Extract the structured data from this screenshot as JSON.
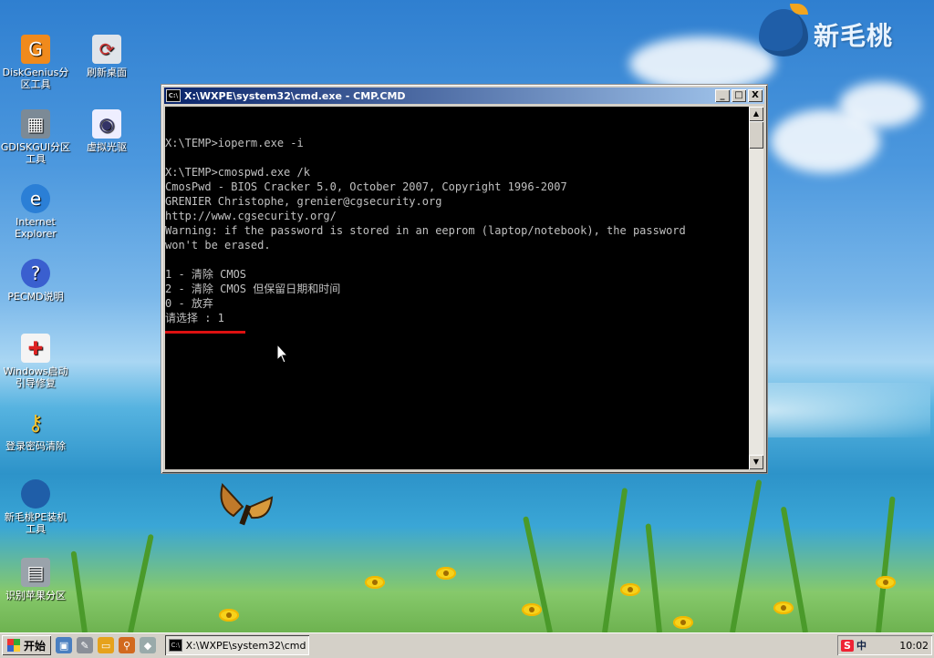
{
  "brand": {
    "text": "新毛桃"
  },
  "desktop_icons": [
    {
      "label": "DiskGenius分区工具",
      "icon": "diskgenius-icon"
    },
    {
      "label": "刷新桌面",
      "icon": "refresh-desktop-icon"
    },
    {
      "label": "GDISKGUI分区工具",
      "icon": "gdiskgui-icon"
    },
    {
      "label": "虚拟光驱",
      "icon": "virtual-drive-icon"
    },
    {
      "label": "Internet Explorer",
      "icon": "internet-explorer-icon"
    },
    {
      "label": "PECMD说明",
      "icon": "help-icon"
    },
    {
      "label": "Windows启动引导修复",
      "icon": "boot-repair-icon"
    },
    {
      "label": "登录密码清除",
      "icon": "key-icon"
    },
    {
      "label": "新毛桃PE装机工具",
      "icon": "peach-installer-icon"
    },
    {
      "label": "识别苹果分区",
      "icon": "apple-partition-icon"
    }
  ],
  "window": {
    "title": "X:\\WXPE\\system32\\cmd.exe - CMP.CMD",
    "title_icon_text": "C:\\",
    "minimize": "_",
    "maximize": "□",
    "close": "X"
  },
  "console_lines": [
    "",
    "X:\\TEMP>ioperm.exe -i",
    "",
    "X:\\TEMP>cmospwd.exe /k",
    "CmosPwd - BIOS Cracker 5.0, October 2007, Copyright 1996-2007",
    "GRENIER Christophe, grenier@cgsecurity.org",
    "http://www.cgsecurity.org/",
    "Warning: if the password is stored in an eeprom (laptop/notebook), the password",
    "won't be erased.",
    "",
    "1 - 清除 CMOS",
    "2 - 清除 CMOS 但保留日期和时间",
    "0 - 放弃",
    "请选择 : 1"
  ],
  "taskbar": {
    "start_label": "开始",
    "task_label": "X:\\WXPE\\system32\\cmd....",
    "task_icon_text": "C:\\",
    "ime_label": "S",
    "lang_label": "中",
    "clock": "10:02"
  },
  "colors": {
    "title_active_start": "#0a246a",
    "title_active_end": "#a6caf0",
    "console_bg": "#000000",
    "console_fg": "#c0c0c0",
    "highlight_underline": "#dd1111"
  }
}
